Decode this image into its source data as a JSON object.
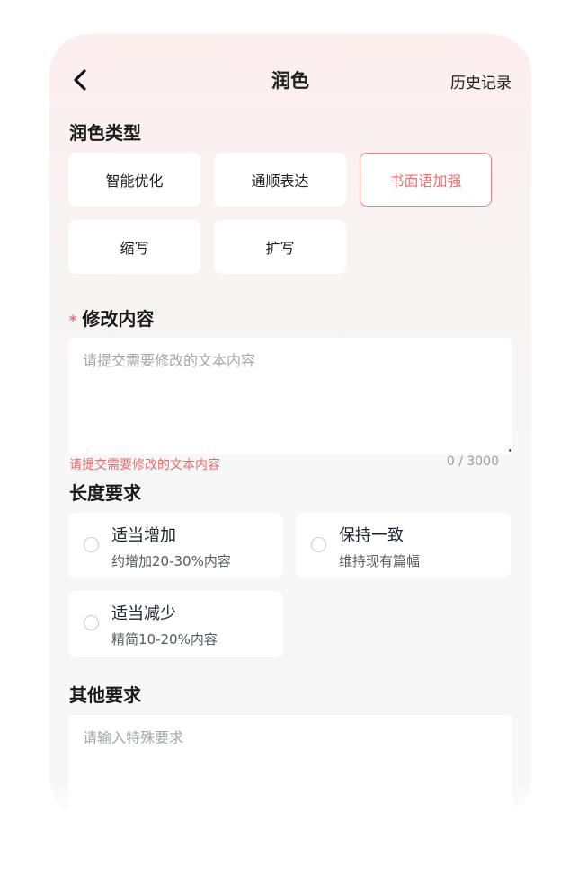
{
  "header": {
    "title": "润色",
    "history_label": "历史记录"
  },
  "polish_type": {
    "label": "润色类型",
    "options": [
      "智能优化",
      "通顺表达",
      "书面语加强",
      "缩写",
      "扩写"
    ],
    "selected": "书面语加强"
  },
  "content": {
    "required_mark": "*",
    "label": "修改内容",
    "placeholder": "请提交需要修改的文本内容",
    "error": "请提交需要修改的文本内容",
    "counter": "0 / 3000"
  },
  "length": {
    "label": "长度要求",
    "options": [
      {
        "title": "适当增加",
        "desc": "约增加20-30%内容"
      },
      {
        "title": "保持一致",
        "desc": "维持现有篇幅"
      },
      {
        "title": "适当减少",
        "desc": "精简10-20%内容"
      }
    ]
  },
  "other": {
    "label": "其他要求",
    "placeholder": "请输入特殊要求"
  },
  "colors": {
    "accent": "#ef6f6f",
    "background": "#f7f7f7"
  }
}
